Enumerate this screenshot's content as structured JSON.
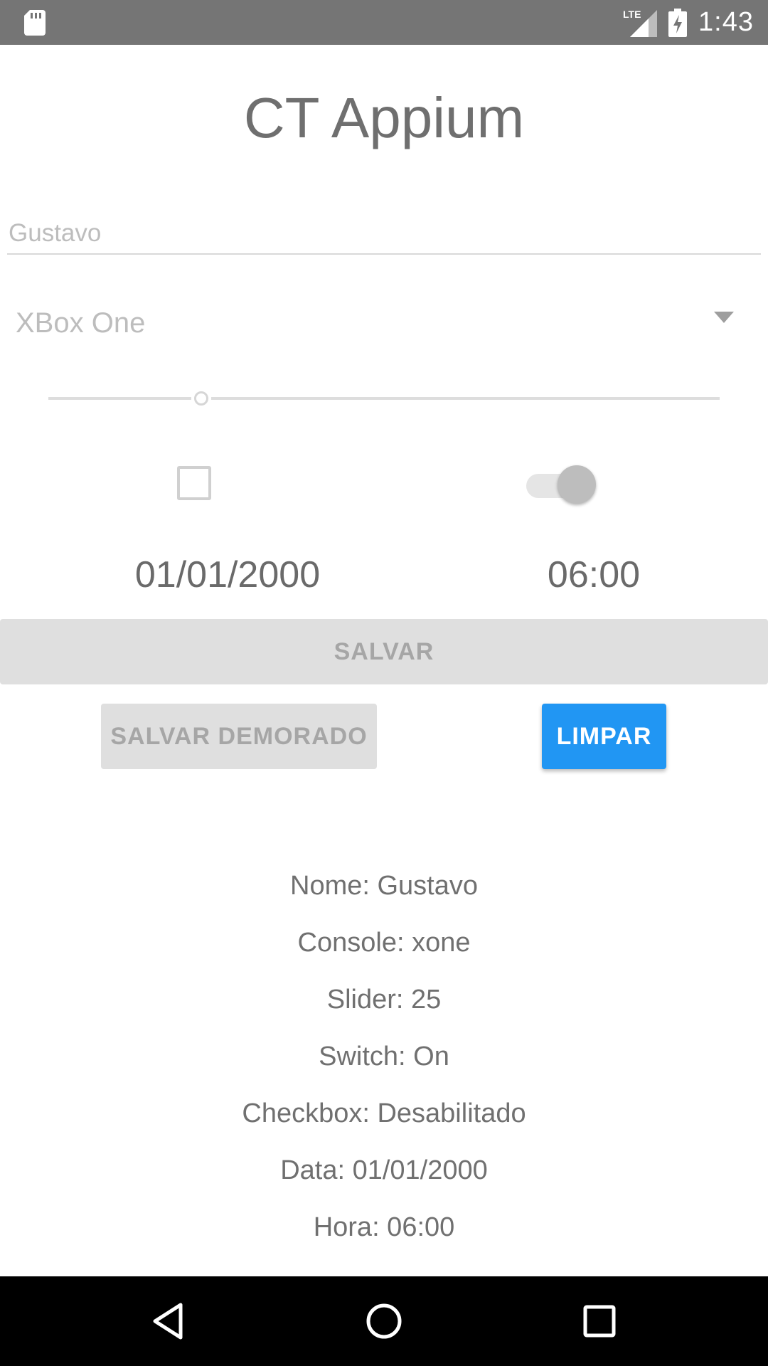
{
  "status_bar": {
    "network": "LTE",
    "time": "1:43"
  },
  "app": {
    "title": "CT Appium"
  },
  "form": {
    "name_value": "Gustavo",
    "console_selected": "XBox One",
    "slider_value": 25,
    "slider_max": 100,
    "checkbox_checked": false,
    "switch_on": true,
    "date": "01/01/2000",
    "time": "06:00"
  },
  "buttons": {
    "save": "SALVAR",
    "save_delayed": "SALVAR DEMORADO",
    "clear": "LIMPAR"
  },
  "results": [
    "Nome: Gustavo",
    "Console: xone",
    "Slider: 25",
    "Switch: On",
    "Checkbox: Desabilitado",
    "Data: 01/01/2000",
    "Hora: 06:00"
  ],
  "colors": {
    "status_bar": "#757575",
    "accent": "#2196f3",
    "nav_bar": "#000000"
  },
  "icons": {
    "sd": "sd-card-icon",
    "signal": "lte-signal-icon",
    "battery": "battery-charging-icon",
    "back": "back-triangle-icon",
    "home": "home-circle-icon",
    "recents": "recents-square-icon"
  }
}
